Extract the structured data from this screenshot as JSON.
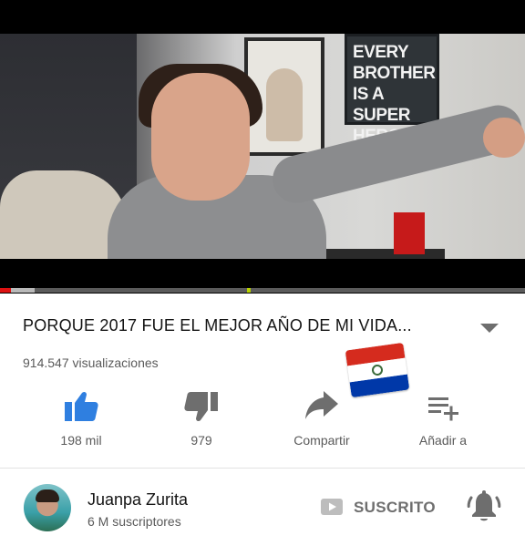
{
  "video": {
    "poster_text": [
      "EVERY",
      "BROTHER",
      "IS A",
      "SUPER HERO"
    ],
    "progress_fraction": 0.02,
    "buffered_fraction": 0.065
  },
  "title": "PORQUE 2017 FUE EL MEJOR AÑO DE MI VIDA...",
  "views": "914.547 visualizaciones",
  "actions": [
    {
      "icon": "thumbs-up-icon",
      "label": "198 mil",
      "color": "#2f7fe0"
    },
    {
      "icon": "thumbs-down-icon",
      "label": "979",
      "color": "#6e6e6e"
    },
    {
      "icon": "share-icon",
      "label": "Compartir",
      "color": "#6e6e6e"
    },
    {
      "icon": "add-to-playlist-icon",
      "label": "Añadir a",
      "color": "#6e6e6e"
    }
  ],
  "channel": {
    "name": "Juanpa Zurita",
    "subscribers": "6 M suscriptores",
    "subscribe_label": "SUSCRITO"
  },
  "sticker": "paraguay-flag"
}
